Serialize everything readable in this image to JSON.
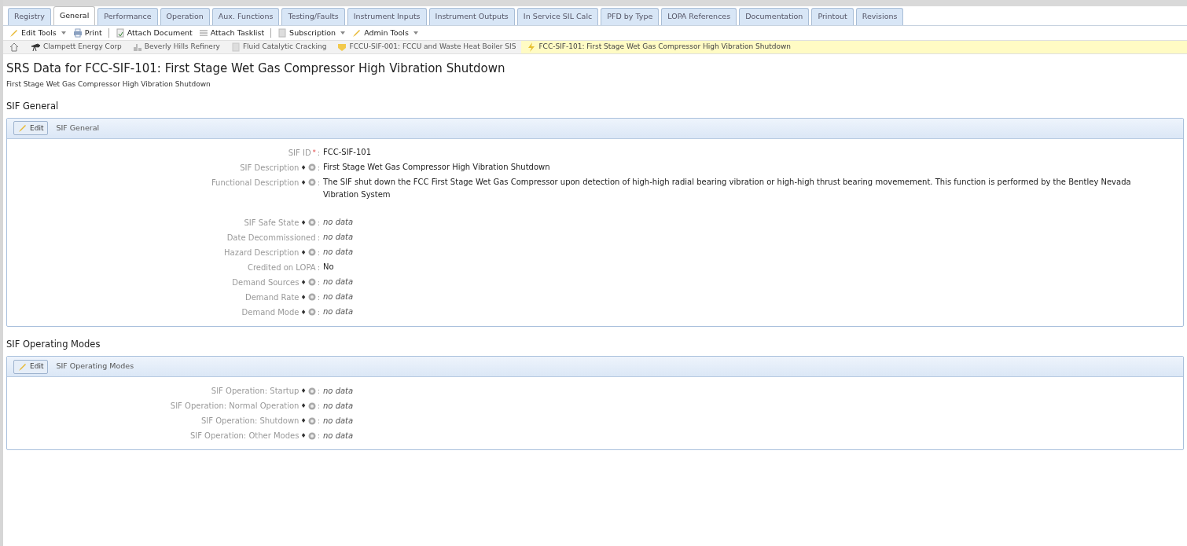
{
  "tabs": [
    {
      "label": "Registry",
      "selected": false
    },
    {
      "label": "General",
      "selected": true
    },
    {
      "label": "Performance",
      "selected": false
    },
    {
      "label": "Operation",
      "selected": false
    },
    {
      "label": "Aux. Functions",
      "selected": false
    },
    {
      "label": "Testing/Faults",
      "selected": false
    },
    {
      "label": "Instrument Inputs",
      "selected": false
    },
    {
      "label": "Instrument Outputs",
      "selected": false
    },
    {
      "label": "In Service SIL Calc",
      "selected": false
    },
    {
      "label": "PFD by Type",
      "selected": false
    },
    {
      "label": "LOPA References",
      "selected": false
    },
    {
      "label": "Documentation",
      "selected": false
    },
    {
      "label": "Printout",
      "selected": false
    },
    {
      "label": "Revisions",
      "selected": false
    }
  ],
  "toolbar": [
    {
      "kind": "pencil",
      "label": "Edit Tools",
      "dropdown": true
    },
    {
      "kind": "printer",
      "label": "Print",
      "dropdown": false
    },
    {
      "kind": "separator"
    },
    {
      "kind": "clip",
      "label": "Attach Document",
      "dropdown": false
    },
    {
      "kind": "list",
      "label": "Attach Tasklist",
      "dropdown": false
    },
    {
      "kind": "separator"
    },
    {
      "kind": "doc",
      "label": "Subscription",
      "dropdown": true
    },
    {
      "kind": "pencil",
      "label": "Admin Tools",
      "dropdown": true
    }
  ],
  "breadcrumb": [
    {
      "kind": "home",
      "selected": false
    },
    {
      "kind": "company",
      "label": "Clampett Energy Corp",
      "selected": false
    },
    {
      "kind": "site",
      "label": "Beverly Hills Refinery",
      "selected": false
    },
    {
      "kind": "unit",
      "label": "Fluid Catalytic Cracking",
      "selected": false
    },
    {
      "kind": "sis",
      "label": "FCCU-SIF-001: FCCU and Waste Heat Boiler SIS",
      "selected": false
    },
    {
      "kind": "sif",
      "label": "FCC-SIF-101: First Stage Wet Gas Compressor High Vibration Shutdown",
      "selected": true
    }
  ],
  "title": "SRS Data for FCC-SIF-101: First Stage Wet Gas Compressor High Vibration Shutdown",
  "subtitle": "First Stage Wet Gas Compressor High Vibration Shutdown",
  "sections": [
    {
      "heading": "SIF General",
      "edit_button": "Edit",
      "panel_title": "SIF General",
      "fields": [
        {
          "label": "SIF ID",
          "marker": "*",
          "required": true,
          "help": false,
          "suffix": ":",
          "value": "FCC-SIF-101",
          "empty": false,
          "gap_after": false
        },
        {
          "label": "SIF Description",
          "marker": "♦",
          "required": false,
          "help": true,
          "suffix": ":",
          "value": "First Stage Wet Gas Compressor High Vibration Shutdown",
          "empty": false,
          "gap_after": false
        },
        {
          "label": "Functional Description",
          "marker": "♦",
          "required": false,
          "help": true,
          "suffix": ":",
          "value": "The SIF shut down the FCC First Stage Wet Gas Compressor upon detection of high-high radial bearing vibration or high-high thrust bearing movemement. This function is performed by the Bentley Nevada Vibration System",
          "empty": false,
          "gap_after": true
        },
        {
          "label": "SIF Safe State",
          "marker": "♦",
          "required": false,
          "help": true,
          "suffix": ":",
          "value": "no data",
          "empty": true,
          "gap_after": false
        },
        {
          "label": "Date Decommissioned",
          "help": false,
          "suffix": ":",
          "value": "no data",
          "empty": true,
          "gap_after": false
        },
        {
          "label": "Hazard Description",
          "marker": "♦",
          "required": false,
          "help": true,
          "suffix": ":",
          "value": "no data",
          "empty": true,
          "gap_after": false
        },
        {
          "label": "Credited on LOPA",
          "help": false,
          "suffix": ":",
          "value": "No",
          "empty": false,
          "gap_after": false
        },
        {
          "label": "Demand Sources",
          "marker": "♦",
          "required": false,
          "help": true,
          "suffix": ":",
          "value": "no data",
          "empty": true,
          "gap_after": false
        },
        {
          "label": "Demand Rate",
          "marker": "♦",
          "required": false,
          "help": true,
          "suffix": ":",
          "value": "no data",
          "empty": true,
          "gap_after": false
        },
        {
          "label": "Demand Mode",
          "marker": "♦",
          "required": false,
          "help": true,
          "suffix": ":",
          "value": "no data",
          "empty": true,
          "gap_after": false
        }
      ]
    },
    {
      "heading": "SIF Operating Modes",
      "edit_button": "Edit",
      "panel_title": "SIF Operating Modes",
      "fields": [
        {
          "label": "SIF Operation: Startup",
          "marker": "♦",
          "required": false,
          "help": true,
          "suffix": ":",
          "value": "no data",
          "empty": true,
          "gap_after": false
        },
        {
          "label": "SIF Operation: Normal Operation",
          "marker": "♦",
          "required": false,
          "help": true,
          "suffix": ":",
          "value": "no data",
          "empty": true,
          "gap_after": false
        },
        {
          "label": "SIF Operation: Shutdown",
          "marker": "♦",
          "required": false,
          "help": true,
          "suffix": ":",
          "value": "no data",
          "empty": true,
          "gap_after": false
        },
        {
          "label": "SIF Operation: Other Modes",
          "marker": "♦",
          "required": false,
          "help": true,
          "suffix": ":",
          "value": "no data",
          "empty": true,
          "gap_after": false
        }
      ]
    }
  ]
}
